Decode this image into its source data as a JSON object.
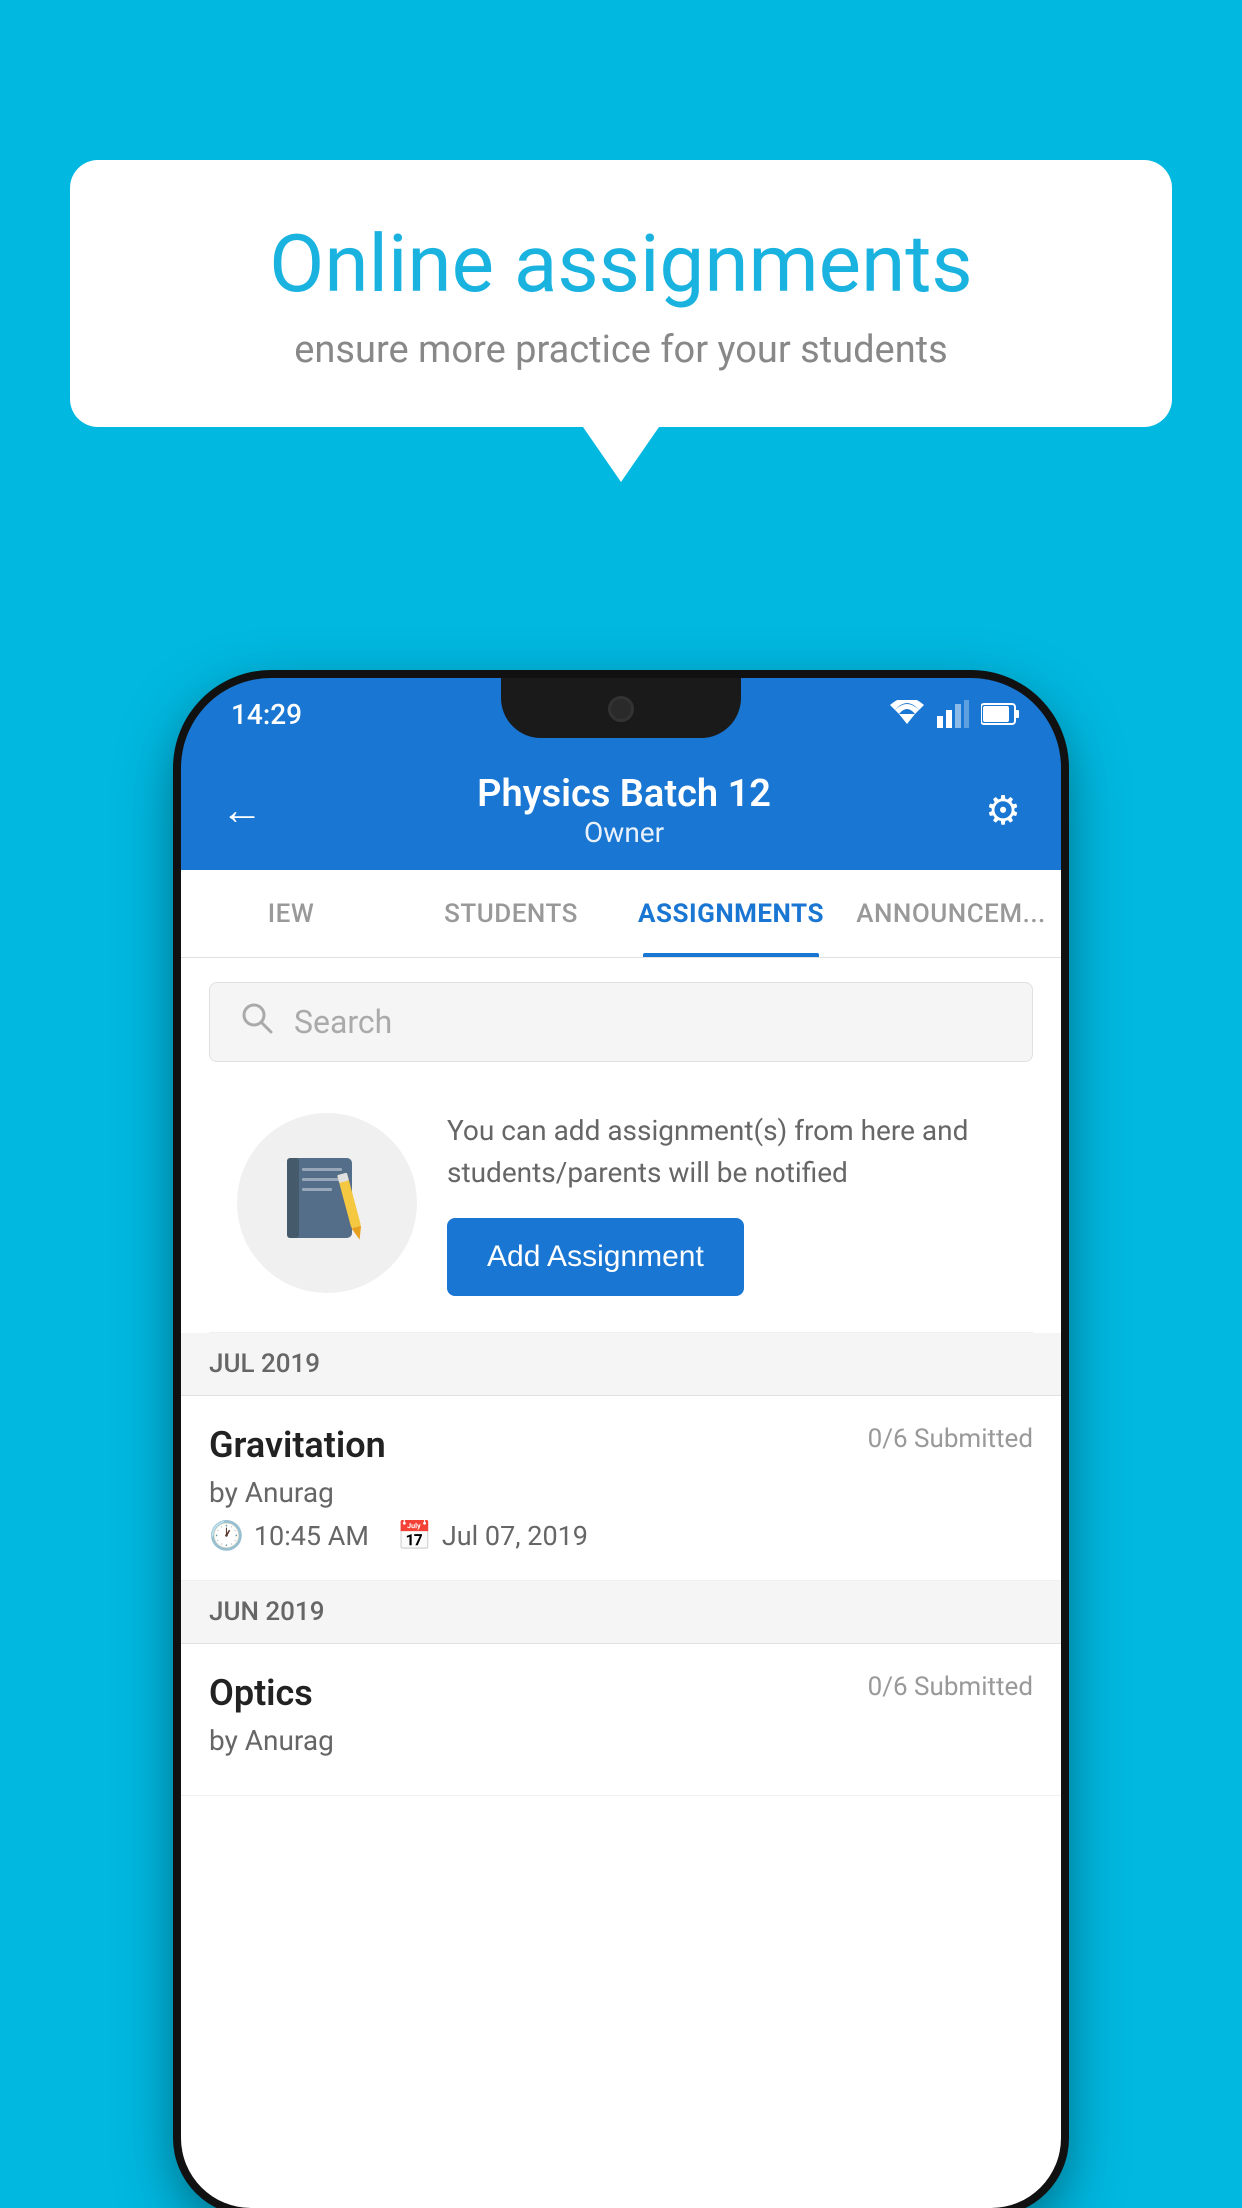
{
  "background_color": "#00b8e0",
  "speech_bubble": {
    "title": "Online assignments",
    "subtitle": "ensure more practice for your students"
  },
  "status_bar": {
    "time": "14:29"
  },
  "header": {
    "title": "Physics Batch 12",
    "subtitle": "Owner",
    "back_label": "←",
    "gear_label": "⚙"
  },
  "tabs": [
    {
      "label": "IEW",
      "active": false
    },
    {
      "label": "STUDENTS",
      "active": false
    },
    {
      "label": "ASSIGNMENTS",
      "active": true
    },
    {
      "label": "ANNOUNCEM...",
      "active": false
    }
  ],
  "search": {
    "placeholder": "Search"
  },
  "promo": {
    "description": "You can add assignment(s) from here and students/parents will be notified",
    "button_label": "Add Assignment"
  },
  "sections": [
    {
      "label": "JUL 2019",
      "assignments": [
        {
          "name": "Gravitation",
          "submitted": "0/6 Submitted",
          "by": "by Anurag",
          "time": "10:45 AM",
          "date": "Jul 07, 2019"
        }
      ]
    },
    {
      "label": "JUN 2019",
      "assignments": [
        {
          "name": "Optics",
          "submitted": "0/6 Submitted",
          "by": "by Anurag",
          "time": "",
          "date": ""
        }
      ]
    }
  ]
}
